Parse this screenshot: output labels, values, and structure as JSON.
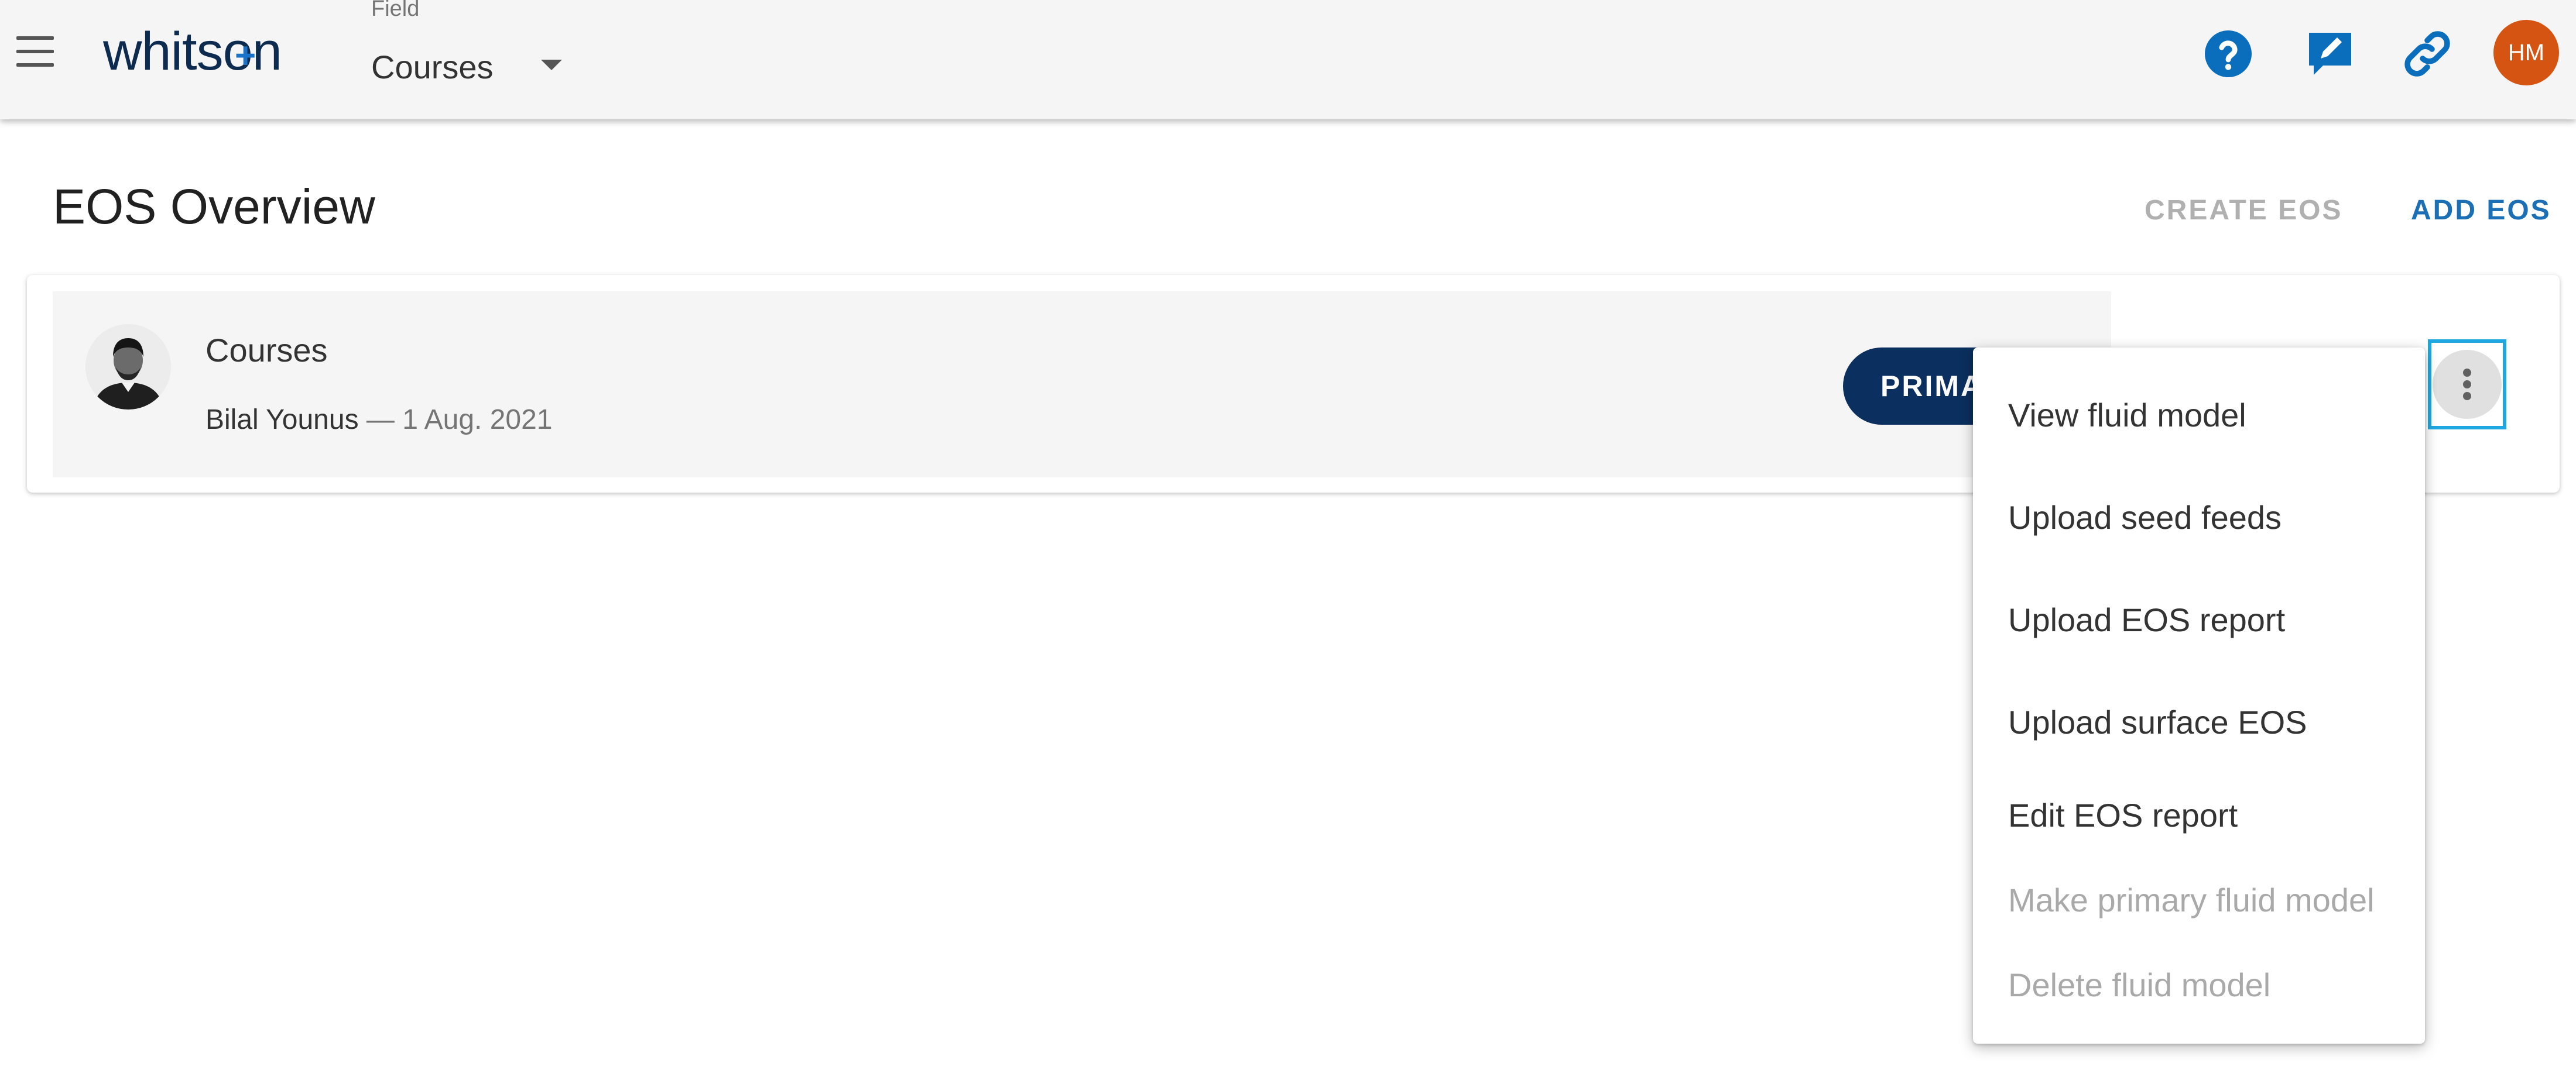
{
  "app": {
    "logo_text": "whitson",
    "logo_plus": "+",
    "field_label": "Field",
    "field_value": "Courses",
    "avatar_initials": "HM",
    "brand_color": "#0d2a4f",
    "accent_color": "#1a6fb5",
    "icons": [
      "menu-icon",
      "help-icon",
      "edit-note-icon",
      "link-icon"
    ]
  },
  "page": {
    "title": "EOS Overview",
    "create_label": "CREATE EOS",
    "add_label": "ADD EOS"
  },
  "eos_list": [
    {
      "title": "Courses",
      "author": "Bilal Younus",
      "separator": "—",
      "date": "1 Aug. 2021",
      "badge": "PRIMARY"
    }
  ],
  "context_menu": {
    "items": [
      {
        "label": "View fluid model",
        "enabled": true
      },
      {
        "label": "Upload seed feeds",
        "enabled": true
      },
      {
        "label": "Upload EOS report",
        "enabled": true
      },
      {
        "label": "Upload surface EOS",
        "enabled": true
      },
      {
        "label": "Edit EOS report",
        "enabled": true
      },
      {
        "label": "Make primary fluid model",
        "enabled": false
      },
      {
        "label": "Delete fluid model",
        "enabled": false
      }
    ]
  }
}
